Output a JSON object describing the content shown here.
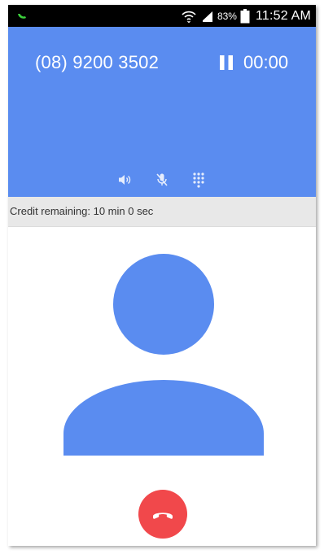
{
  "status_bar": {
    "battery_percent": "83%",
    "time": "11:52 AM",
    "icons": [
      "call-active-icon",
      "wifi-icon",
      "signal-icon",
      "battery-icon"
    ]
  },
  "call": {
    "number": "(08) 9200 3502",
    "timer": "00:00",
    "controls": [
      "speaker-icon",
      "mute-icon",
      "dialpad-icon"
    ]
  },
  "credit": {
    "text": "Credit remaining: 10 min 0 sec"
  },
  "colors": {
    "header": "#5a8cf0",
    "avatar": "#5a8cf0",
    "end_call": "#f1484b",
    "credit_bar": "#e8e8e8"
  }
}
